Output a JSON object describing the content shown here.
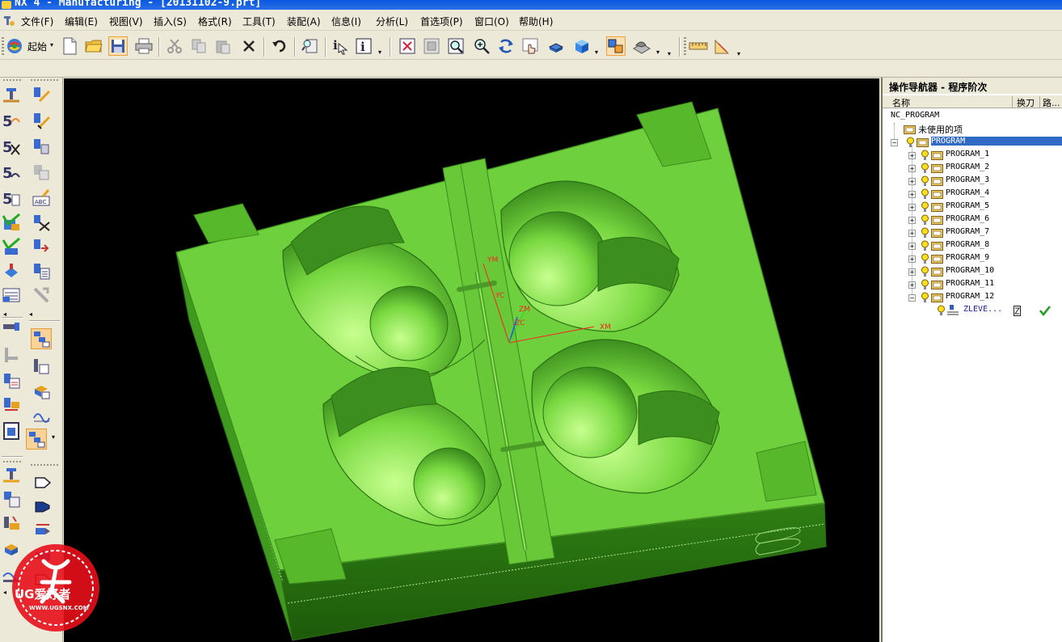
{
  "window": {
    "title": "NX 4 - Manufacturing - [20131102-9.prt]"
  },
  "menu": {
    "items": [
      "文件(F)",
      "编辑(E)",
      "视图(V)",
      "插入(S)",
      "格式(R)",
      "工具(T)",
      "装配(A)",
      "信息(I)",
      "分析(L)",
      "首选项(P)",
      "窗口(O)",
      "帮助(H)"
    ]
  },
  "toolbar": {
    "start_label": "起始",
    "icons": [
      "new-file-icon",
      "open-folder-icon",
      "save-icon",
      "print-icon",
      "cut-icon",
      "copy-icon",
      "paste-icon",
      "delete-icon",
      "undo-icon",
      "find-icon",
      "info-icon",
      "info-object-icon",
      "fit-view-icon",
      "zoom-window-icon",
      "zoom-icon",
      "zoom-in-out-icon",
      "rotate-icon",
      "pan-icon",
      "fly-icon",
      "render-style-icon",
      "view-orient-icon",
      "layer-icon",
      "measure-distance-icon",
      "measure-angle-icon"
    ]
  },
  "viewport": {
    "csys_labels": {
      "ym": "YM",
      "yc": "YC",
      "zm": "ZM",
      "zc": "ZC",
      "xm": "XM"
    },
    "part_color": "#6ed03c",
    "background": "#000000"
  },
  "navigator": {
    "title": "操作导航器 - 程序阶次",
    "columns": [
      "名称",
      "换刀",
      "路..."
    ],
    "root": "NC_PROGRAM",
    "unused": "未使用的项",
    "program": "PROGRAM",
    "children": [
      "PROGRAM_1",
      "PROGRAM_2",
      "PROGRAM_3",
      "PROGRAM_4",
      "PROGRAM_5",
      "PROGRAM_6",
      "PROGRAM_7",
      "PROGRAM_8",
      "PROGRAM_9",
      "PROGRAM_10",
      "PROGRAM_11",
      "PROGRAM_12"
    ],
    "operation": "ZLEVE...",
    "selected_color": "#316ac5"
  },
  "watermark": {
    "text": "UG爱好者",
    "url": "WWW.UGSNX.COM"
  }
}
